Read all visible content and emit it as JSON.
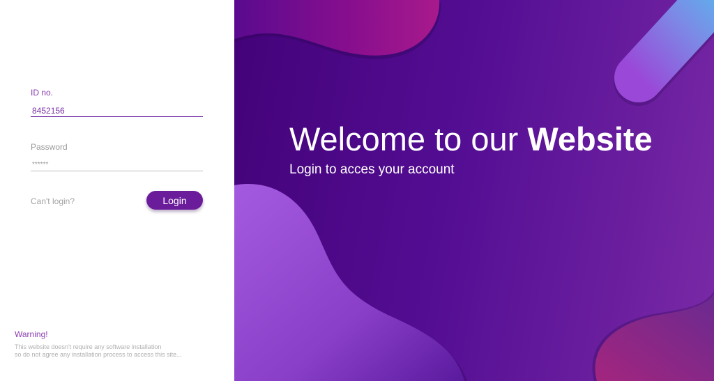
{
  "login_form": {
    "id_label": "ID no.",
    "id_value": "8452156",
    "password_label": "Password",
    "password_masked": "******",
    "cant_login": "Can't login?",
    "login_button": "Login"
  },
  "warning": {
    "title": "Warning!",
    "line1": "This website doesn't require any software installation",
    "line2": "so do not agree any installation process to access this site..."
  },
  "hero": {
    "title_regular": "Welcome to our",
    "title_bold": "Website",
    "subtitle": "Login to acces your account"
  },
  "colors": {
    "accent": "#6a1c9a",
    "label_active": "#8a3cb0",
    "panel_bg_start": "#430278",
    "panel_bg_end": "#7a2aa6"
  }
}
